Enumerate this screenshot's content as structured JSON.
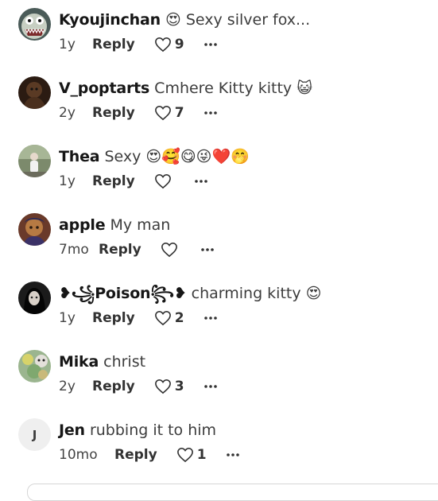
{
  "comments": [
    {
      "username": "Kyoujinchan",
      "text": "😍 Sexy silver fox...",
      "time": "1y",
      "reply_label": "Reply",
      "likes": "9",
      "avatar_initial": ""
    },
    {
      "username": "V_poptarts",
      "text": "Cmhere Kitty kitty 😺",
      "time": "2y",
      "reply_label": "Reply",
      "likes": "7",
      "avatar_initial": ""
    },
    {
      "username": "Thea",
      "text": "Sexy 😍🥰😋😜❤️🤭",
      "time": "1y",
      "reply_label": "Reply",
      "likes": "",
      "avatar_initial": ""
    },
    {
      "username": "apple",
      "text": "My man",
      "time": "7mo",
      "reply_label": "Reply",
      "likes": "",
      "avatar_initial": ""
    },
    {
      "username": "❥꧁Poison꧂❥",
      "text": "charming kitty 😍",
      "time": "1y",
      "reply_label": "Reply",
      "likes": "2",
      "avatar_initial": ""
    },
    {
      "username": "Mika",
      "text": "christ",
      "time": "2y",
      "reply_label": "Reply",
      "likes": "3",
      "avatar_initial": ""
    },
    {
      "username": "Jen",
      "text": "rubbing it to him",
      "time": "10mo",
      "reply_label": "Reply",
      "likes": "1",
      "avatar_initial": "J"
    }
  ]
}
